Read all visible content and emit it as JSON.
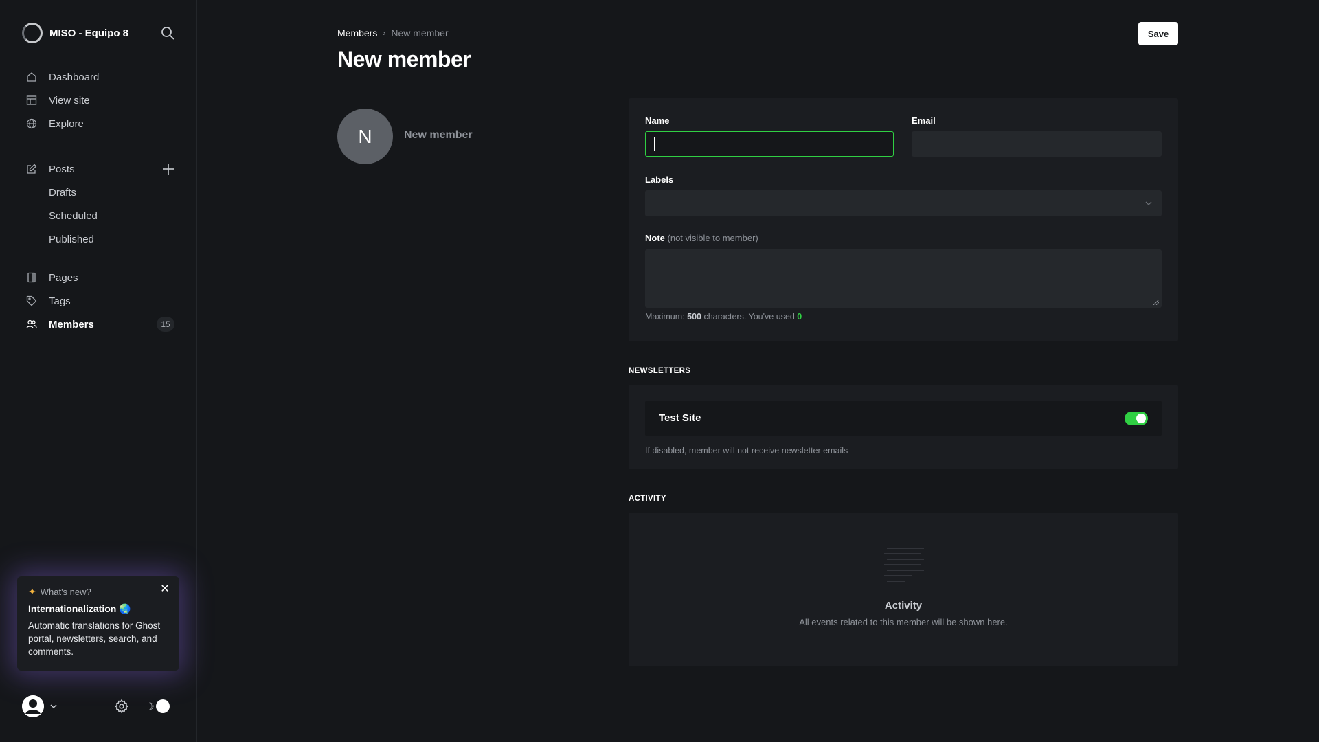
{
  "sidebar": {
    "site_title": "MISO - Equipo 8",
    "nav": [
      {
        "label": "Dashboard",
        "icon": "home-icon"
      },
      {
        "label": "View site",
        "icon": "layout-icon"
      },
      {
        "label": "Explore",
        "icon": "globe-icon"
      }
    ],
    "posts": {
      "label": "Posts",
      "sub": [
        "Drafts",
        "Scheduled",
        "Published"
      ]
    },
    "content": [
      {
        "label": "Pages",
        "icon": "page-icon"
      },
      {
        "label": "Tags",
        "icon": "tag-icon"
      },
      {
        "label": "Members",
        "icon": "members-icon",
        "count": "15",
        "active": true
      }
    ],
    "whats_new": {
      "heading": "What's new?",
      "title": "Internationalization",
      "title_emoji": "🌏",
      "body": "Automatic translations for Ghost portal, newsletters, search, and comments."
    }
  },
  "header": {
    "breadcrumb_parent": "Members",
    "breadcrumb_current": "New member",
    "title": "New member",
    "save_label": "Save"
  },
  "member": {
    "initial": "N",
    "name": "New member"
  },
  "form": {
    "name_label": "Name",
    "name_value": "",
    "email_label": "Email",
    "email_value": "",
    "labels_label": "Labels",
    "note_label": "Note",
    "note_hint": "(not visible to member)",
    "note_value": "",
    "help_prefix": "Maximum: ",
    "help_max": "500",
    "help_middle": " characters. You've used ",
    "help_used": "0"
  },
  "newsletters": {
    "section_label": "NEWSLETTERS",
    "items": [
      {
        "name": "Test Site",
        "enabled": true
      }
    ],
    "help": "If disabled, member will not receive newsletter emails"
  },
  "activity": {
    "section_label": "ACTIVITY",
    "title": "Activity",
    "subtitle": "All events related to this member will be shown here."
  },
  "colors": {
    "background": "#15171a",
    "panel": "#1b1d21",
    "accent_green": "#30cf43"
  }
}
